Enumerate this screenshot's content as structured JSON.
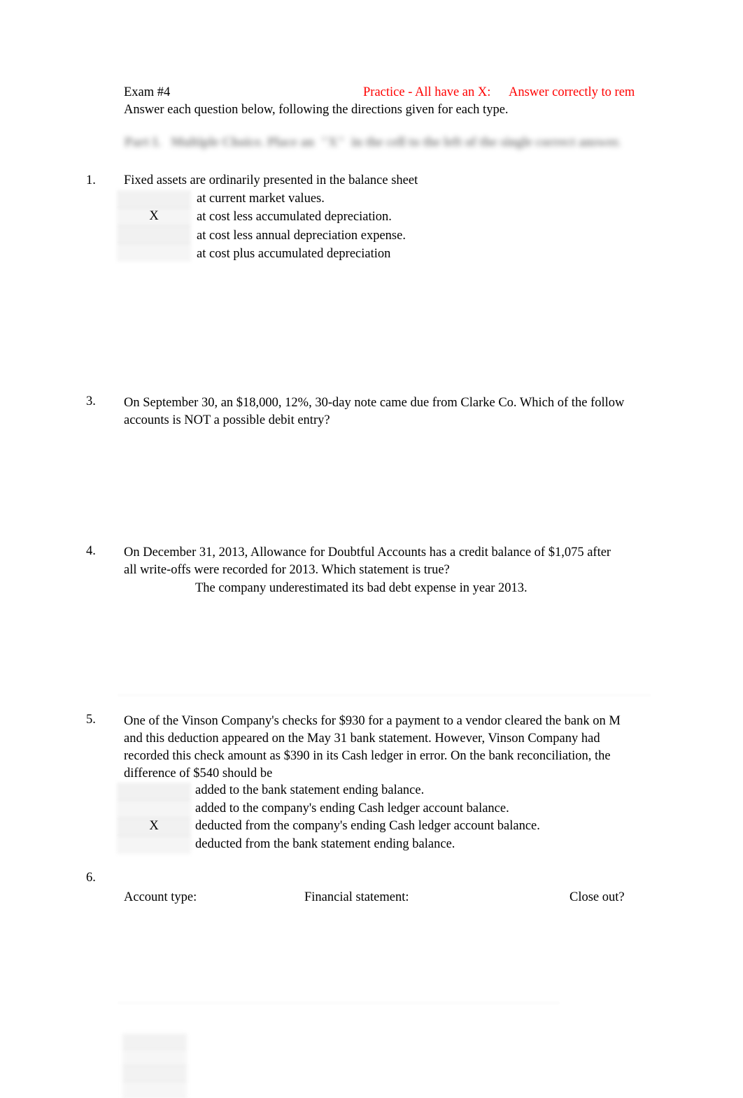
{
  "document": {
    "title": "Exam #4",
    "subtitle": "Answer each question below, following the directions given for each type.",
    "header_note_1": "Practice - All have an X:",
    "header_note_2": "Answer correctly to rem",
    "note_color": "#ff0000",
    "part_heading": "Part I.   Multiple Choice. Place an  \"X\"  in the cell to the left of the single correct answer.",
    "mark_symbol": "X"
  },
  "questions": [
    {
      "number": "1.",
      "prompt_lines": [
        "Fixed assets are ordinarily presented in the balance sheet"
      ],
      "options": [
        "at current market values.",
        "at cost less accumulated depreciation.",
        "at cost less annual depreciation expense.",
        "at cost plus accumulated depreciation"
      ],
      "marked_index": 1
    },
    {
      "number": "3.",
      "prompt_lines": [
        "On September 30, an $18,000, 12%, 30-day note came due from Clarke Co.           Which of the follow",
        "accounts is NOT a possible debit entry?"
      ],
      "options": [],
      "marked_index": -1
    },
    {
      "number": "4.",
      "prompt_lines": [
        "On December 31, 2013, Allowance for Doubtful Accounts has a credit balance of $1,075 after",
        "all write-offs were recorded for 2013.       Which statement is true?"
      ],
      "extra_line": "The company underestimated its bad debt expense in year 2013.",
      "options": [],
      "marked_index": -1
    },
    {
      "number": "5.",
      "prompt_lines": [
        "One of the Vinson Company's checks for $930 for a payment to a vendor cleared the bank on M",
        "and this deduction appeared on the May 31 bank statement.             However, Vinson Company had",
        "recorded this check amount as $390 in its Cash ledger in error.             On the bank reconciliation, the",
        "difference of $540 should be"
      ],
      "options": [
        "added to the bank statement ending balance.",
        "added to the company's ending Cash ledger account balance.",
        "deducted from the company's ending Cash ledger account balance.",
        "deducted from the bank statement ending balance."
      ],
      "marked_index": 2
    },
    {
      "number": "6.",
      "prompt_lines": [],
      "column_headers": {
        "account_type": "Account type:",
        "financial_statement": "Financial statement:",
        "close_out": "Close out?"
      },
      "options": [],
      "marked_index": -1
    }
  ]
}
